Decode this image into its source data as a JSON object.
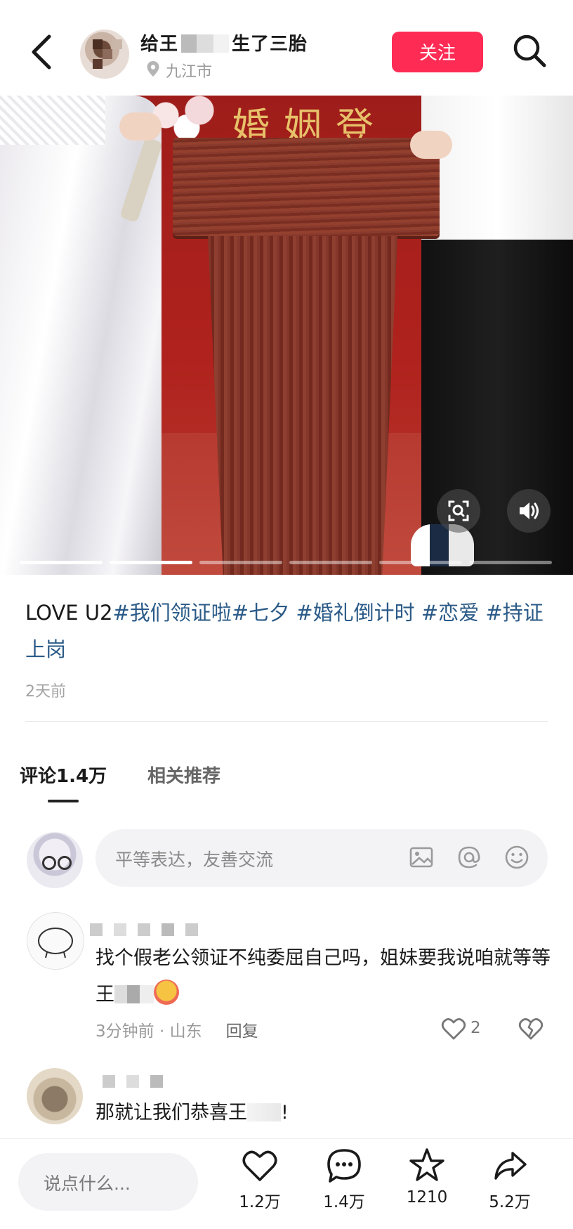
{
  "header": {
    "username_prefix": "给王",
    "username_suffix": "生了三胎",
    "location": "九江市",
    "follow_label": "关注"
  },
  "photo": {
    "sign_text": "婚姻登",
    "slide_count": 6,
    "active_slides": [
      0,
      1
    ]
  },
  "post": {
    "caption_plain": "LOVE U2",
    "hashtags": [
      "#我们领证啦",
      "#七夕",
      " #婚礼倒计时",
      " #恋爱",
      " #持证上岗"
    ],
    "time": "2天前"
  },
  "tabs": {
    "comments": "评论1.4万",
    "related": "相关推荐"
  },
  "comment_input": {
    "placeholder": "平等表达，友善交流"
  },
  "comments": [
    {
      "text_before": "找个假老公领证不纯委屈自己吗，姐妹要我说咱就等等王",
      "time_location": "3分钟前 · 山东",
      "reply_label": "回复",
      "likes": "2"
    },
    {
      "text_before": "那就让我们恭喜王",
      "text_after": "!"
    }
  ],
  "bottom_bar": {
    "say_placeholder": "说点什么...",
    "likes": "1.2万",
    "comments": "1.4万",
    "favorites": "1210",
    "shares": "5.2万"
  },
  "colors": {
    "accent": "#fe2c55",
    "hashtag": "#2a5a87"
  }
}
